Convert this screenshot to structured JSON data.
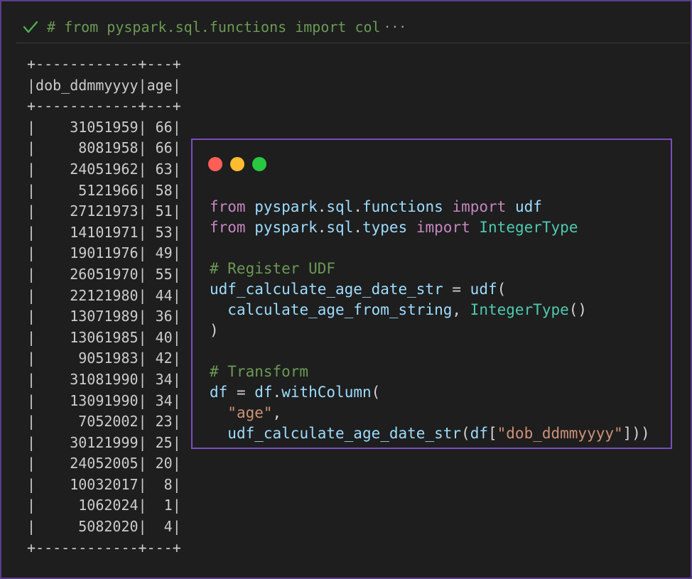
{
  "cell": {
    "header_code": "# from pyspark.sql.functions import col",
    "status_icon": "check-icon",
    "status_color": "#4caf50",
    "more_indicator": "···"
  },
  "output": {
    "border_top": "+------------+---+",
    "header_row": "|dob_ddmmyyyy|age|",
    "border_mid": "+------------+---+",
    "columns": [
      "dob_ddmmyyyy",
      "age"
    ],
    "rows": [
      {
        "dob": "31051959",
        "age": "66"
      },
      {
        "dob": "8081958",
        "age": "66"
      },
      {
        "dob": "24051962",
        "age": "63"
      },
      {
        "dob": "5121966",
        "age": "58"
      },
      {
        "dob": "27121973",
        "age": "51"
      },
      {
        "dob": "14101971",
        "age": "53"
      },
      {
        "dob": "19011976",
        "age": "49"
      },
      {
        "dob": "26051970",
        "age": "55"
      },
      {
        "dob": "22121980",
        "age": "44"
      },
      {
        "dob": "13071989",
        "age": "36"
      },
      {
        "dob": "13061985",
        "age": "40"
      },
      {
        "dob": "9051983",
        "age": "42"
      },
      {
        "dob": "31081990",
        "age": "34"
      },
      {
        "dob": "13091990",
        "age": "34"
      },
      {
        "dob": "7052002",
        "age": "23"
      },
      {
        "dob": "30121999",
        "age": "25"
      },
      {
        "dob": "24052005",
        "age": "20"
      },
      {
        "dob": "10032017",
        "age": "8"
      },
      {
        "dob": "1062024",
        "age": "1"
      },
      {
        "dob": "5082020",
        "age": "4"
      }
    ],
    "border_bottom": "+------------+---+"
  },
  "snippet": {
    "window_dots": [
      {
        "name": "close-dot",
        "color": "#ff5f57"
      },
      {
        "name": "minimize-dot",
        "color": "#febc2e"
      },
      {
        "name": "maximize-dot",
        "color": "#28c840"
      }
    ],
    "code_lines": [
      [
        [
          "kw",
          "from"
        ],
        [
          "pl",
          " "
        ],
        [
          "vr",
          "pyspark"
        ],
        [
          "pl",
          "."
        ],
        [
          "vr",
          "sql"
        ],
        [
          "pl",
          "."
        ],
        [
          "vr",
          "functions"
        ],
        [
          "pl",
          " "
        ],
        [
          "kw",
          "import"
        ],
        [
          "pl",
          " "
        ],
        [
          "vr",
          "udf"
        ]
      ],
      [
        [
          "kw",
          "from"
        ],
        [
          "pl",
          " "
        ],
        [
          "vr",
          "pyspark"
        ],
        [
          "pl",
          "."
        ],
        [
          "vr",
          "sql"
        ],
        [
          "pl",
          "."
        ],
        [
          "vr",
          "types"
        ],
        [
          "pl",
          " "
        ],
        [
          "kw",
          "import"
        ],
        [
          "pl",
          " "
        ],
        [
          "ty",
          "IntegerType"
        ]
      ],
      [],
      [
        [
          "cm",
          "# Register UDF"
        ]
      ],
      [
        [
          "vr",
          "udf_calculate_age_date_str"
        ],
        [
          "pl",
          " = "
        ],
        [
          "vr",
          "udf"
        ],
        [
          "pl",
          "("
        ]
      ],
      [
        [
          "pl",
          "  "
        ],
        [
          "vr",
          "calculate_age_from_string"
        ],
        [
          "pl",
          ", "
        ],
        [
          "ty",
          "IntegerType"
        ],
        [
          "pl",
          "()"
        ]
      ],
      [
        [
          "pl",
          ")"
        ]
      ],
      [],
      [
        [
          "cm",
          "# Transform"
        ]
      ],
      [
        [
          "vr",
          "df"
        ],
        [
          "pl",
          " = "
        ],
        [
          "vr",
          "df"
        ],
        [
          "pl",
          "."
        ],
        [
          "vr",
          "withColumn"
        ],
        [
          "pl",
          "("
        ]
      ],
      [
        [
          "pl",
          "  "
        ],
        [
          "st",
          "\"age\""
        ],
        [
          "pl",
          ","
        ]
      ],
      [
        [
          "pl",
          "  "
        ],
        [
          "vr",
          "udf_calculate_age_date_str"
        ],
        [
          "pl",
          "("
        ],
        [
          "vr",
          "df"
        ],
        [
          "pl",
          "["
        ],
        [
          "st",
          "\"dob_ddmmyyyy\""
        ],
        [
          "pl",
          "]))"
        ]
      ]
    ]
  }
}
